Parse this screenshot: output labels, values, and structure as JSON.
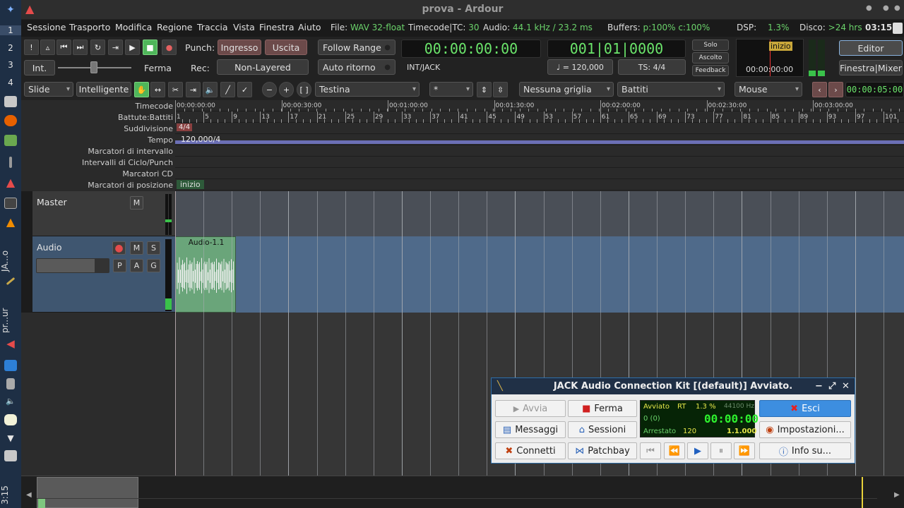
{
  "dock": {
    "workspaces": [
      "1",
      "2",
      "3",
      "4"
    ],
    "window_labels": [
      "JA...o",
      "pr...ur"
    ],
    "clock": "3:15"
  },
  "window": {
    "title": "prova - Ardour"
  },
  "menu": [
    "Sessione",
    "Trasporto",
    "Modifica",
    "Regione",
    "Traccia",
    "Vista",
    "Finestra",
    "Aiuto"
  ],
  "status": {
    "file_label": "File:",
    "file_value": "WAV 32-float",
    "tc_label": "Timecode|TC:",
    "tc_value": "30",
    "audio_label": "Audio:",
    "audio_value": "44.1 kHz / 23.2 ms",
    "buffers_label": "Buffers:",
    "buffers_value": "p:100% c:100%",
    "dsp_label": "DSP:",
    "dsp_value": "1.3%",
    "disk_label": "Disco:",
    "disk_value": ">24 hrs",
    "time": "03:15"
  },
  "transport": {
    "punch_label": "Punch:",
    "punch_in": "Ingresso",
    "punch_out": "Uscita",
    "rec_label": "Rec:",
    "rec_mode": "Non-Layered",
    "int_button": "Int.",
    "stop_label": "Ferma",
    "follow_range": "Follow Range",
    "auto_return": "Auto ritorno",
    "sync": "INT/JACK",
    "primary_clock": "00:00:00:00",
    "secondary_clock": "001|01|0000",
    "tempo": "♩ = 120,000",
    "ts": "TS: 4/4",
    "solo": "Solo",
    "ascolto": "Ascolto",
    "feedback": "Feedback",
    "mini_marker": "inizio",
    "mini_time": "00:00:00:00",
    "editor_btn": "Editor",
    "mixer_btn": "Finestra|Mixer"
  },
  "edit": {
    "mode": "Slide",
    "smart": "Intelligente",
    "point": "Testina",
    "zoom_opt": "*",
    "grid": "Nessuna griglia",
    "grid_type": "Battiti",
    "draw_mode": "Mouse",
    "nudge_clock": "00:00:05:00"
  },
  "rulers": {
    "labels": [
      "Timecode",
      "Battute:Battiti",
      "Suddivisione",
      "Tempo",
      "Marcatori di intervallo",
      "Intervalli di Ciclo/Punch",
      "Marcatori CD",
      "Marcatori di posizione"
    ],
    "timecodes": [
      "00:00:00:00",
      "00:00:30:00",
      "00:01:00:00",
      "00:01:30:00",
      "00:02:00:00",
      "00:02:30:00",
      "00:03:00:00"
    ],
    "bars": [
      "1",
      "5",
      "9",
      "13",
      "17",
      "21",
      "25",
      "29",
      "33",
      "37",
      "41",
      "45",
      "49",
      "53",
      "57",
      "61",
      "65",
      "69",
      "73",
      "77",
      "81",
      "85",
      "89",
      "93",
      "97",
      "101"
    ],
    "meter": "4/4",
    "tempo": "120,000/4",
    "marker": "inizio"
  },
  "tracks": {
    "master": {
      "name": "Master",
      "mute": "M"
    },
    "audio": {
      "name": "Audio",
      "mute": "M",
      "solo": "S",
      "p": "P",
      "a": "A",
      "g": "G",
      "region": "Audio-1.1"
    }
  },
  "jack": {
    "title": "JACK Audio Connection Kit [(default)] Avviato.",
    "start": "Avvia",
    "stop": "Ferma",
    "quit": "Esci",
    "messages": "Messaggi",
    "sessions": "Sessioni",
    "setup": "Impostazioni...",
    "connect": "Connetti",
    "patchbay": "Patchbay",
    "about": "Info su...",
    "state": "Avviato",
    "rt": "RT",
    "load": "1.3 %",
    "rate": "44100 Hz",
    "xruns": "0 (0)",
    "time": "00:00:00",
    "transport_state": "Arrestato",
    "bpm": "120",
    "bbt": "1.1.000"
  },
  "colors": {
    "accent": "#4fb65a",
    "clock": "#6be56b",
    "dock": "#1e2f45"
  }
}
